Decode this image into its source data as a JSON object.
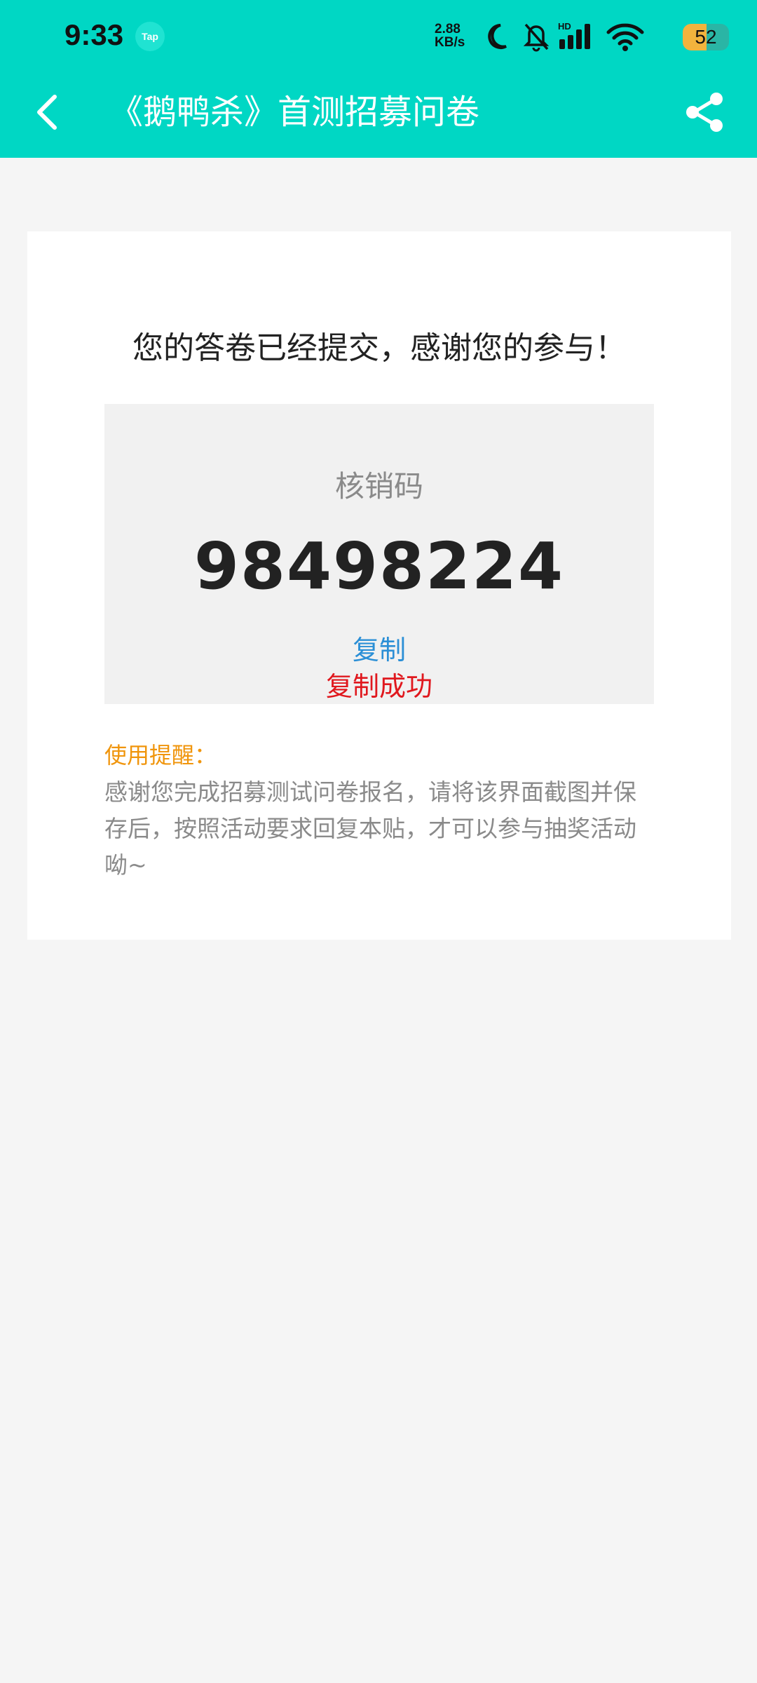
{
  "status_bar": {
    "time": "9:33",
    "app_badge": "Tap",
    "net_speed_value": "2.88",
    "net_speed_unit": "KB/s",
    "battery_level": "52",
    "battery_percent": 52
  },
  "header": {
    "title": "《鹅鸭杀》首测招募问卷",
    "background_color": "#00d7c4"
  },
  "result": {
    "message": "您的答卷已经提交，感谢您的参与！",
    "code_label": "核销码",
    "code_value": "98498224",
    "copy_label": "复制",
    "copy_success": "复制成功"
  },
  "reminder": {
    "title": "使用提醒：",
    "body": "感谢您完成招募测试问卷报名，请将该界面截图并保存后，按照活动要求回复本贴，才可以参与抽奖活动呦~"
  },
  "icons": {
    "back": "chevron-left-icon",
    "share": "share-icon",
    "moon": "moon-icon",
    "bell_off": "bell-off-icon",
    "signal": "signal-icon",
    "wifi": "wifi-icon"
  }
}
